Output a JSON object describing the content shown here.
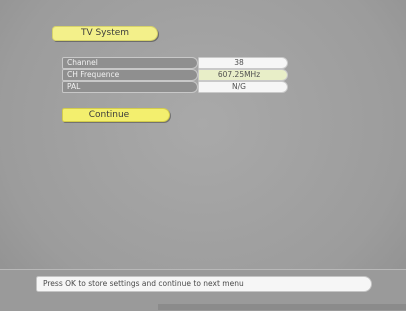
{
  "menu": {
    "title": "TV System",
    "rows": [
      {
        "label": "Channel",
        "value": "38"
      },
      {
        "label": "CH Frequence",
        "value": "607.25MHz"
      },
      {
        "label": "PAL",
        "value": "N/G"
      }
    ],
    "continue_label": "Continue"
  },
  "status": {
    "message": "Press OK to store settings and continue to next menu"
  },
  "colors": {
    "accent_yellow": "#f3ef6e",
    "label_bg": "#8f8f8f",
    "value_bg": "#f6f6f6",
    "background": "#9e9e9e"
  }
}
